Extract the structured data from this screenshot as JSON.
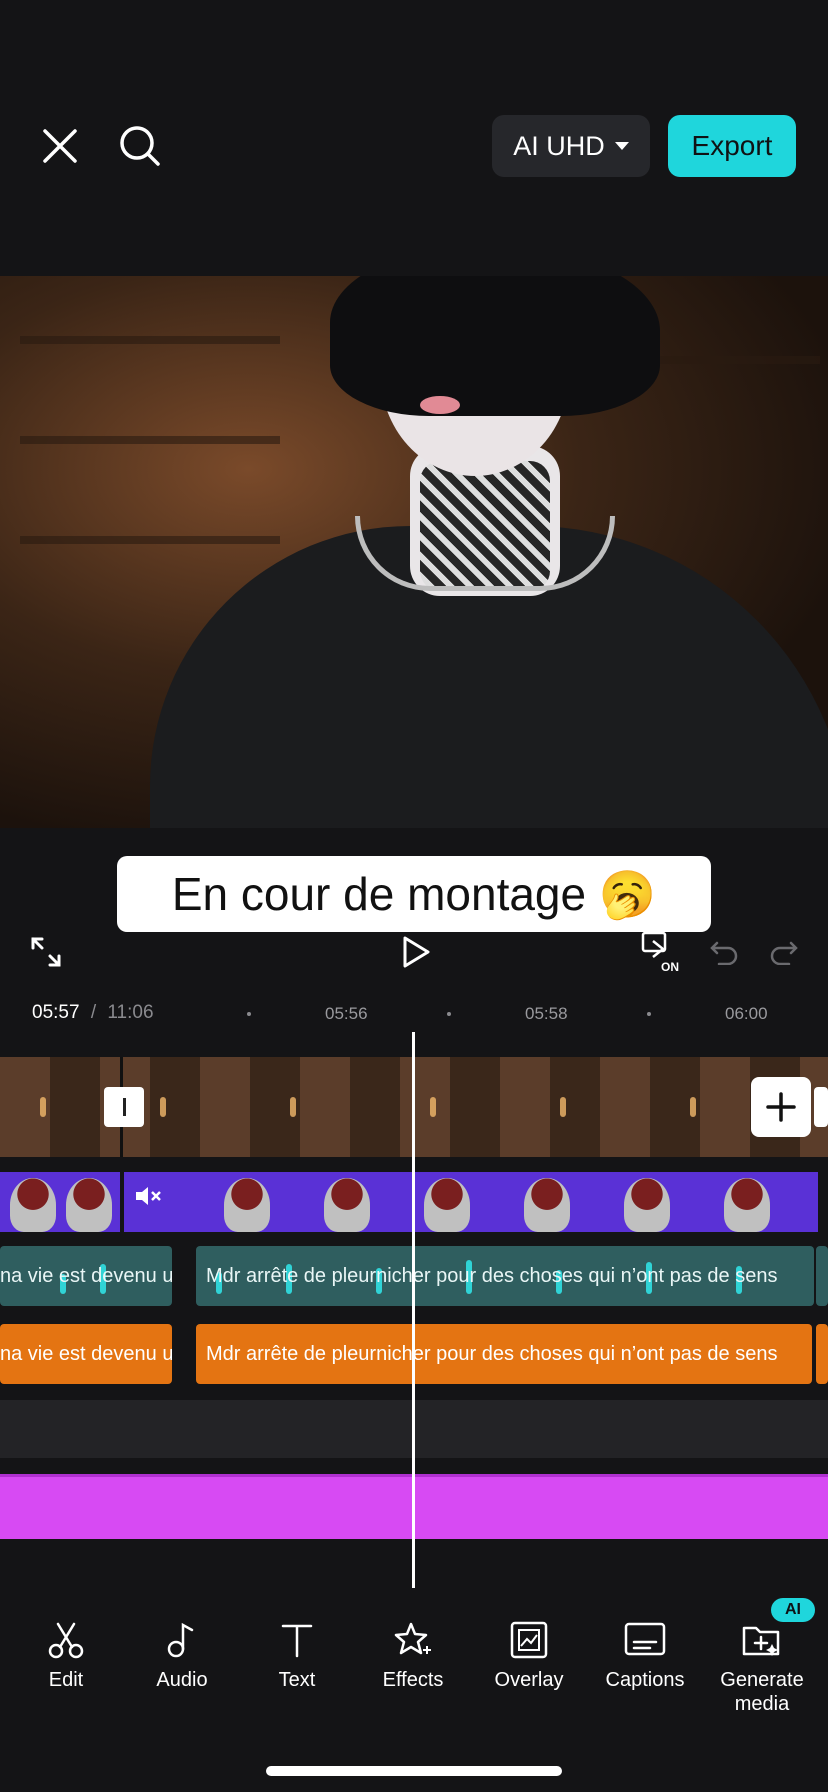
{
  "header": {
    "quality_label": "AI UHD",
    "export_label": "Export"
  },
  "preview": {
    "caption_text": "En cour de montage 🥱"
  },
  "playback": {
    "current_time": "05:57",
    "separator": "/",
    "total_time": "11:06"
  },
  "ruler": {
    "labels": [
      "05:56",
      "05:58",
      "06:00"
    ]
  },
  "tracks": {
    "audio_clip_left": "na vie est devenu u",
    "audio_clip_right": "Mdr arrête de pleurnicher pour des choses qui n’ont pas de sens",
    "text_clip_left": "na vie est devenu u",
    "text_clip_right": "Mdr arrête de pleurnicher pour des choses qui n’ont pas de sens"
  },
  "toolbar": {
    "items": [
      {
        "label": "Edit",
        "icon": "scissors-icon"
      },
      {
        "label": "Audio",
        "icon": "music-note-icon"
      },
      {
        "label": "Text",
        "icon": "text-icon"
      },
      {
        "label": "Effects",
        "icon": "sparkle-star-icon"
      },
      {
        "label": "Overlay",
        "icon": "overlay-icon"
      },
      {
        "label": "Captions",
        "icon": "captions-icon"
      },
      {
        "label": "Generate\nmedia",
        "icon": "generate-media-icon"
      }
    ],
    "ai_badge": "AI"
  },
  "colors": {
    "accent": "#1fd6dc",
    "overlay_track": "#5a31d6",
    "audio_track": "#2f5e5f",
    "text_track": "#e47412",
    "magenta_track": "#d74af3"
  }
}
